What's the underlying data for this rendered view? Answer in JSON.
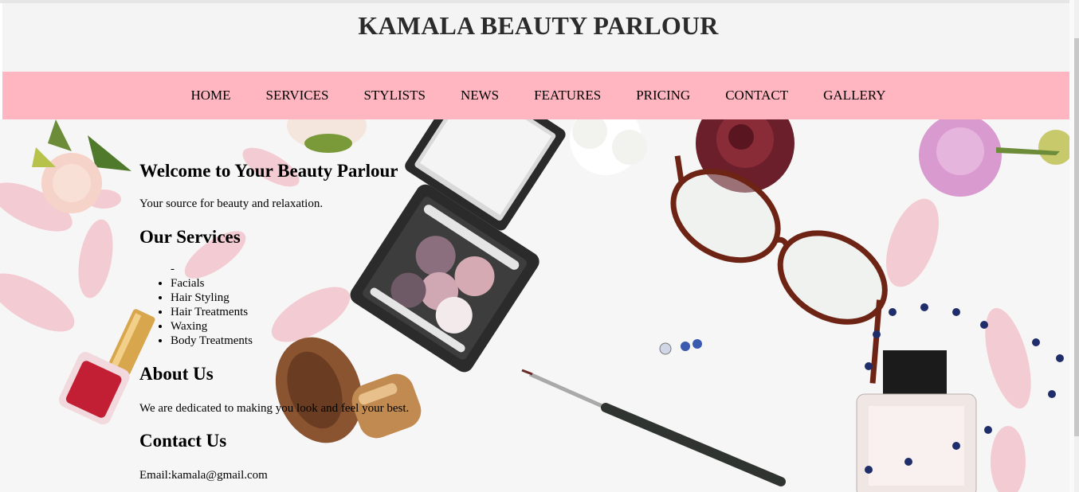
{
  "header": {
    "title": "KAMALA BEAUTY PARLOUR"
  },
  "nav": {
    "items": [
      "HOME",
      "SERVICES",
      "STYLISTS",
      "NEWS",
      "FEATURES",
      "PRICING",
      "CONTACT",
      "GALLERY"
    ]
  },
  "welcome": {
    "heading": "Welcome to Your Beauty Parlour",
    "text": "Your source for beauty and relaxation."
  },
  "services": {
    "heading": "Our Services",
    "dash": "-",
    "items": [
      "Facials",
      "Hair Styling",
      "Hair Treatments",
      "Waxing",
      "Body Treatments"
    ]
  },
  "about": {
    "heading": "About Us",
    "text": "We are dedicated to making you look and feel your best."
  },
  "contact": {
    "heading": "Contact Us",
    "email": "Email:kamala@gmail.com"
  },
  "colors": {
    "nav_bg": "#ffb6c1",
    "header_bg": "#f4f4f4"
  }
}
